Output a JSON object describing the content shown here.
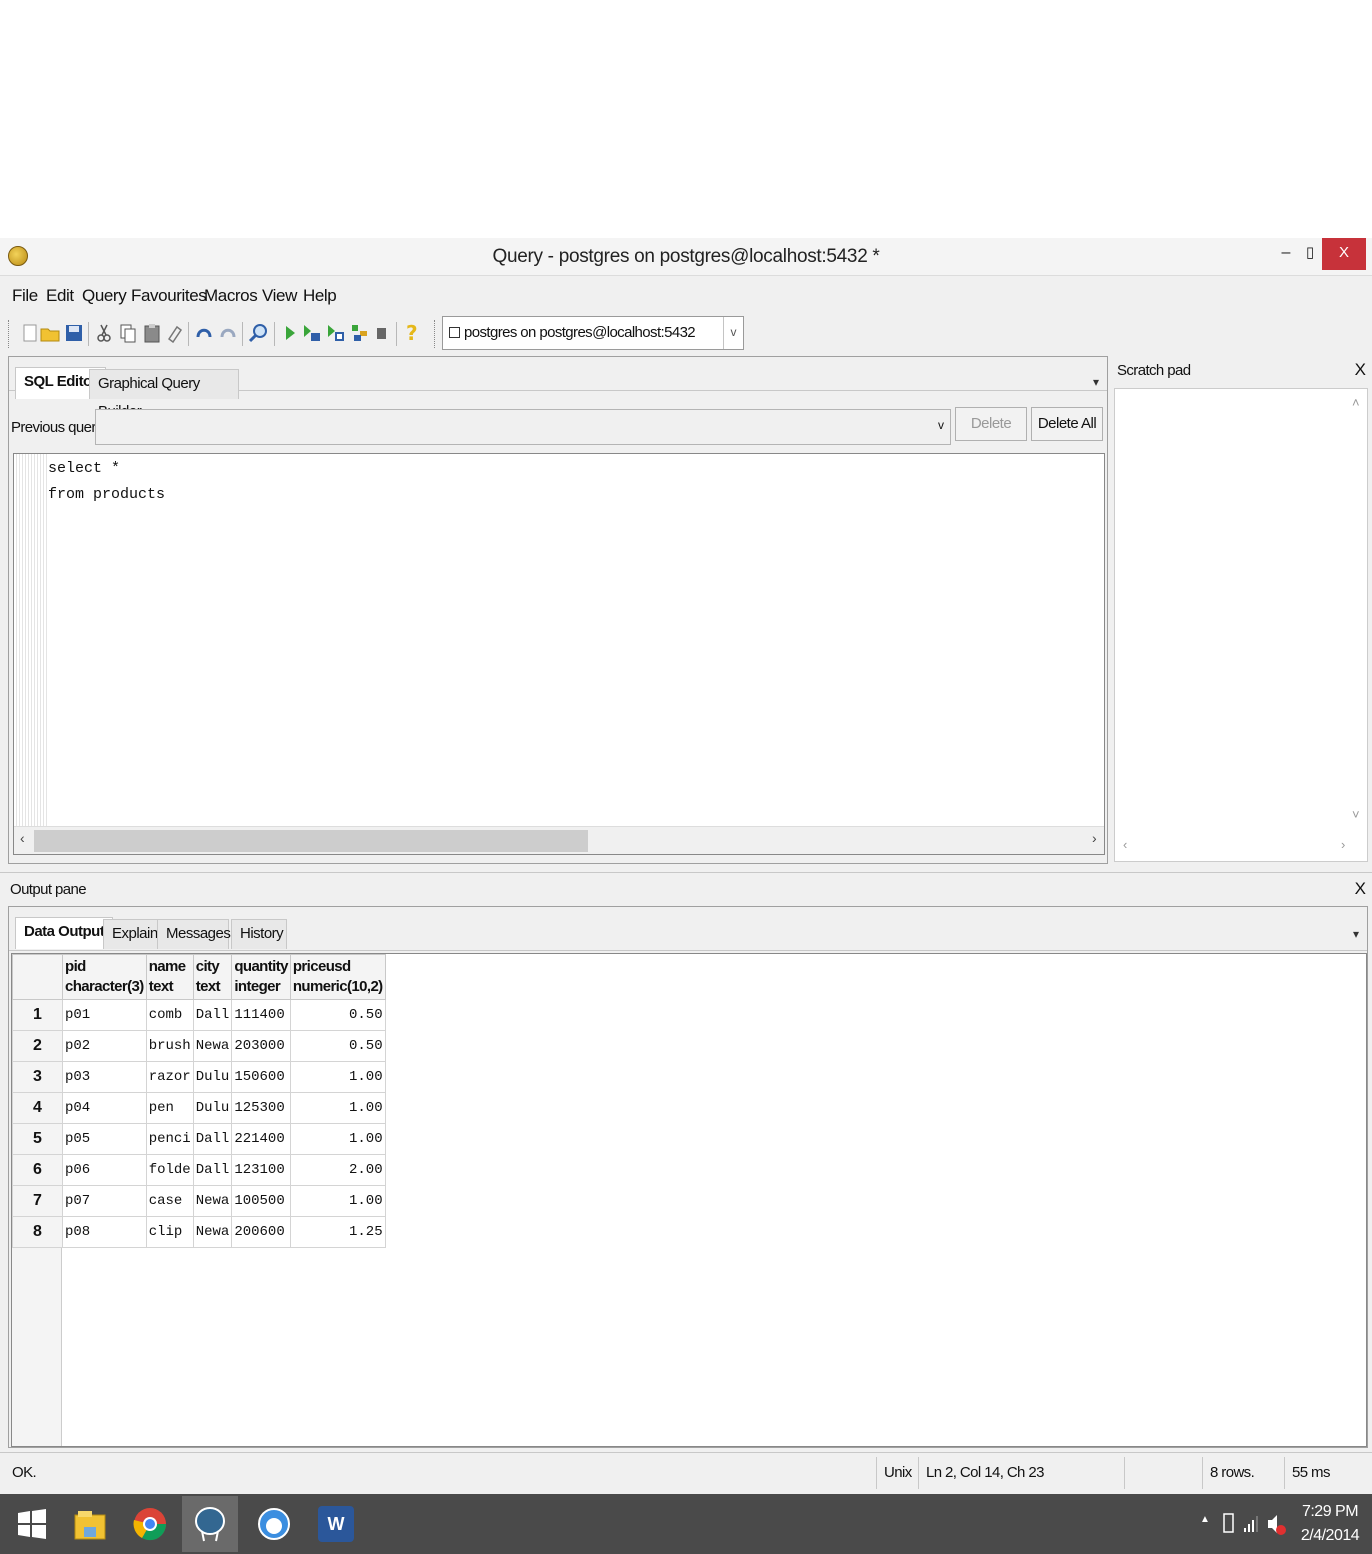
{
  "window": {
    "title": "Query - postgres on postgres@localhost:5432 *",
    "minimize_glyph": "–",
    "maximize_glyph": "▯",
    "close_glyph": "X"
  },
  "menu": {
    "items": [
      "File",
      "Edit",
      "Query",
      "Favourites",
      "Macros",
      "View",
      "Help"
    ]
  },
  "toolbar": {
    "connection": "postgres on postgres@localhost:5432",
    "icons": [
      "new-icon",
      "open-icon",
      "save-icon",
      "cut-icon",
      "copy-icon",
      "paste-icon",
      "clear-icon",
      "undo-icon",
      "redo-icon",
      "find-icon",
      "execute-icon",
      "explain-icon",
      "execute-file-icon",
      "explain-analyze-icon",
      "stop-icon",
      "help-icon"
    ]
  },
  "editor": {
    "tabs": [
      "SQL Editor",
      "Graphical Query Builder"
    ],
    "previous_queries_label": "Previous queries",
    "delete_label": "Delete",
    "delete_all_label": "Delete All",
    "code_lines": [
      "select *",
      "from products"
    ]
  },
  "scratch_pad": {
    "title": "Scratch pad",
    "close": "X"
  },
  "output": {
    "title": "Output pane",
    "close": "X",
    "tabs": [
      "Data Output",
      "Explain",
      "Messages",
      "History"
    ],
    "columns": [
      {
        "name": "pid",
        "type": "character(3)"
      },
      {
        "name": "name",
        "type": "text"
      },
      {
        "name": "city",
        "type": "text"
      },
      {
        "name": "quantity",
        "type": "integer"
      },
      {
        "name": "priceusd",
        "type": "numeric(10,2)"
      }
    ],
    "rows": [
      {
        "num": "1",
        "pid": "p01",
        "name": "comb",
        "city": "Dall",
        "quantity": "111400",
        "priceusd": "0.50"
      },
      {
        "num": "2",
        "pid": "p02",
        "name": "brush",
        "city": "Newa",
        "quantity": "203000",
        "priceusd": "0.50"
      },
      {
        "num": "3",
        "pid": "p03",
        "name": "razor",
        "city": "Dulu",
        "quantity": "150600",
        "priceusd": "1.00"
      },
      {
        "num": "4",
        "pid": "p04",
        "name": "pen",
        "city": "Dulu",
        "quantity": "125300",
        "priceusd": "1.00"
      },
      {
        "num": "5",
        "pid": "p05",
        "name": "penci",
        "city": "Dall",
        "quantity": "221400",
        "priceusd": "1.00"
      },
      {
        "num": "6",
        "pid": "p06",
        "name": "folde",
        "city": "Dall",
        "quantity": "123100",
        "priceusd": "2.00"
      },
      {
        "num": "7",
        "pid": "p07",
        "name": "case",
        "city": "Newa",
        "quantity": "100500",
        "priceusd": "1.00"
      },
      {
        "num": "8",
        "pid": "p08",
        "name": "clip",
        "city": "Newa",
        "quantity": "200600",
        "priceusd": "1.25"
      }
    ]
  },
  "status": {
    "message": "OK.",
    "line_ending": "Unix",
    "position": "Ln 2, Col 14, Ch 23",
    "rows": "8 rows.",
    "time": "55 ms"
  },
  "taskbar": {
    "apps": [
      "start-icon",
      "file-explorer-icon",
      "chrome-icon",
      "pgadmin-icon",
      "app-icon",
      "word-icon"
    ],
    "time": "7:29 PM",
    "date": "2/4/2014"
  }
}
